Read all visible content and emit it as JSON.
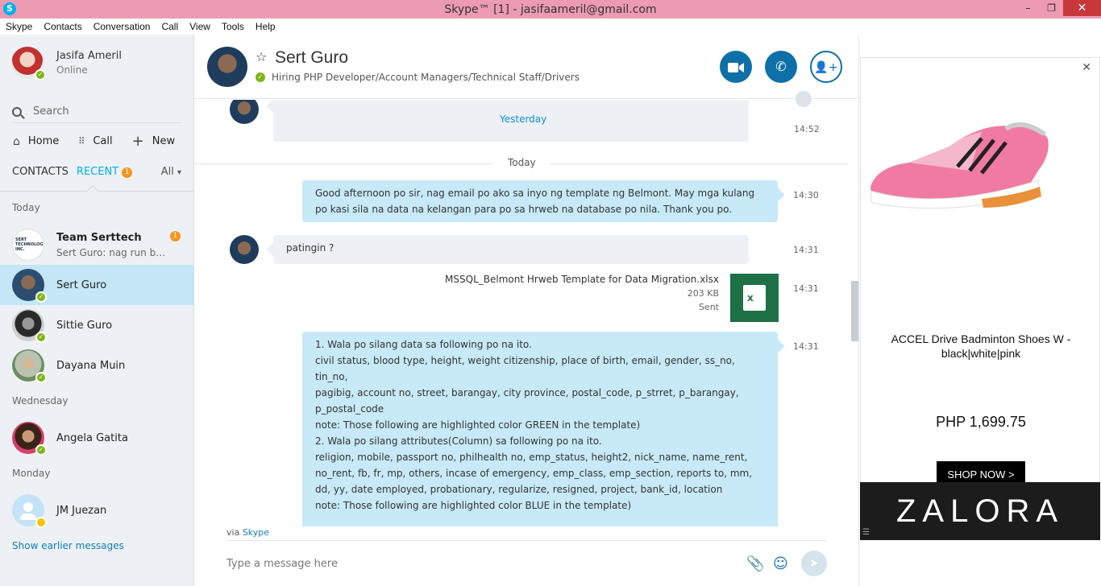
{
  "window": {
    "title": "Skype™ [1] - jasifaameril@gmail.com",
    "minimize": "–",
    "restore": "❐",
    "close": "✕"
  },
  "menu": [
    "Skype",
    "Contacts",
    "Conversation",
    "Call",
    "View",
    "Tools",
    "Help"
  ],
  "profile": {
    "name": "Jasifa Ameril",
    "status": "Online"
  },
  "search": {
    "label": "Search"
  },
  "nav": {
    "home": "Home",
    "call": "Call",
    "new": "New"
  },
  "tabs": {
    "contacts": "CONTACTS",
    "recent": "RECENT",
    "recent_badge": "1",
    "filter": "All"
  },
  "sections": {
    "today": "Today",
    "wednesday": "Wednesday",
    "monday": "Monday"
  },
  "contacts": [
    {
      "name": "Team Serttech",
      "preview": "Sert Guro: nag run ba y...",
      "badge": "1",
      "logo_text": "SERT TECHNOLOGY INC."
    },
    {
      "name": "Sert Guro"
    },
    {
      "name": "Sittie Guro"
    },
    {
      "name": "Dayana Muin"
    },
    {
      "name": "Angela Gatita"
    },
    {
      "name": "JM Juezan"
    }
  ],
  "show_earlier": "Show earlier messages",
  "conversation": {
    "name": "Sert Guro",
    "mood": "Hiring PHP Developer/Account Managers/Technical Staff/Drivers",
    "yesterday_label": "Yesterday",
    "yesterday_time": "14:52",
    "today_label": "Today",
    "messages": [
      {
        "text": "Good afternoon po sir, nag email po ako sa inyo ng template ng Belmont. May mga kulang po kasi sila na data na kelangan para po sa hrweb na database po nila. Thank you po.",
        "time": "14:30"
      },
      {
        "text": "patingin ?",
        "time": "14:31"
      },
      {
        "time": "14:31"
      },
      {
        "lines": [
          "1. Wala po silang data sa following po na ito.",
          "civil status, blood type, height, weight citizenship, place of birth, email, gender, ss_no, tin_no,",
          "pagibig, account no, street, barangay, city province, postal_code, p_strret, p_barangay,",
          "p_postal_code",
          "note: Those following are highlighted color GREEN in the template)",
          "2. Wala po silang attributes(Column) sa following po na ito.",
          "religion, mobile, passport no, philhealth no, emp_status, height2, nick_name, name_rent,",
          "no_rent, fb, fr, mp, others, incase of emergency, emp_class, emp_section, reports to, mm,",
          "dd, yy, date employed, probationary, regularize, resigned, project, bank_id, location",
          "note: Those following are highlighted color BLUE in the template)"
        ],
        "time": "14:31"
      }
    ],
    "file": {
      "name": "MSSQL_Belmont Hrweb Template for Data Migration.xlsx",
      "size": "203 KB",
      "status": "Sent"
    },
    "via_prefix": "via",
    "via_link": "Skype",
    "input_placeholder": "Type a message here"
  },
  "ad": {
    "title": "ACCEL Drive Badminton Shoes W - black|white|pink",
    "price": "PHP 1,699.75",
    "cta": "SHOP NOW >",
    "brand": "ZALORA",
    "close": "✕"
  },
  "colors": {
    "accent": "#00aff0",
    "titlebar": "#ec9bb3",
    "button": "#0f6fa8",
    "online": "#7cb518",
    "badge": "#f7941e"
  }
}
